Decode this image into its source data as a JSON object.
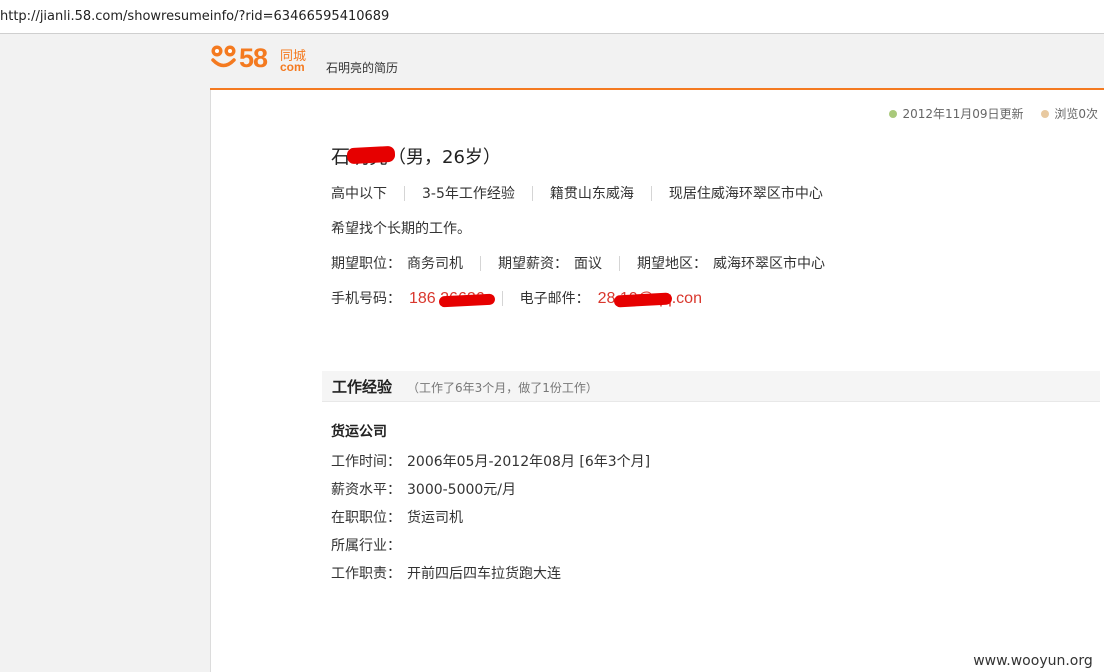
{
  "browser": {
    "url": "http://jianli.58.com/showresumeinfo/?rid=63466595410689"
  },
  "header": {
    "logo": {
      "number": "58",
      "chinese": "同城",
      "domain": "com"
    },
    "page_title": "石明亮的简历"
  },
  "meta": {
    "updated": "2012年11月09日更新",
    "views": "浏览0次",
    "updated_dot_color": "#a9c97b",
    "views_dot_color": "#e8c9a0"
  },
  "profile": {
    "name": "石明亮",
    "gender_age": "（男，26岁）",
    "attributes": [
      "高中以下",
      "3-5年工作经验",
      "籍贯山东威海",
      "现居住威海环翠区市中心"
    ],
    "intro": "希望找个长期的工作。",
    "expectations": [
      {
        "label": "期望职位：",
        "value": "商务司机"
      },
      {
        "label": "期望薪资：",
        "value": "面议"
      },
      {
        "label": "期望地区：",
        "value": "威海环翠区市中心"
      }
    ],
    "contact": {
      "phone_label": "手机号码：",
      "phone_value": "186  26626",
      "email_label": "电子邮件：",
      "email_value": "28   10@qq.con"
    }
  },
  "work_experience": {
    "title": "工作经验",
    "summary": "（工作了6年3个月，做了1份工作）",
    "company": "货运公司",
    "fields": [
      {
        "label": "工作时间：",
        "value": "2006年05月-2012年08月 [6年3个月]"
      },
      {
        "label": "薪资水平：",
        "value": "3000-5000元/月"
      },
      {
        "label": "在职职位：",
        "value": "货运司机"
      },
      {
        "label": "所属行业：",
        "value": ""
      },
      {
        "label": "工作职责：",
        "value": "开前四后四车拉货跑大连"
      }
    ]
  },
  "watermark": "www.wooyun.org",
  "colors": {
    "accent": "#f47a20",
    "contact": "#d9372d",
    "redaction": "#e60000"
  }
}
